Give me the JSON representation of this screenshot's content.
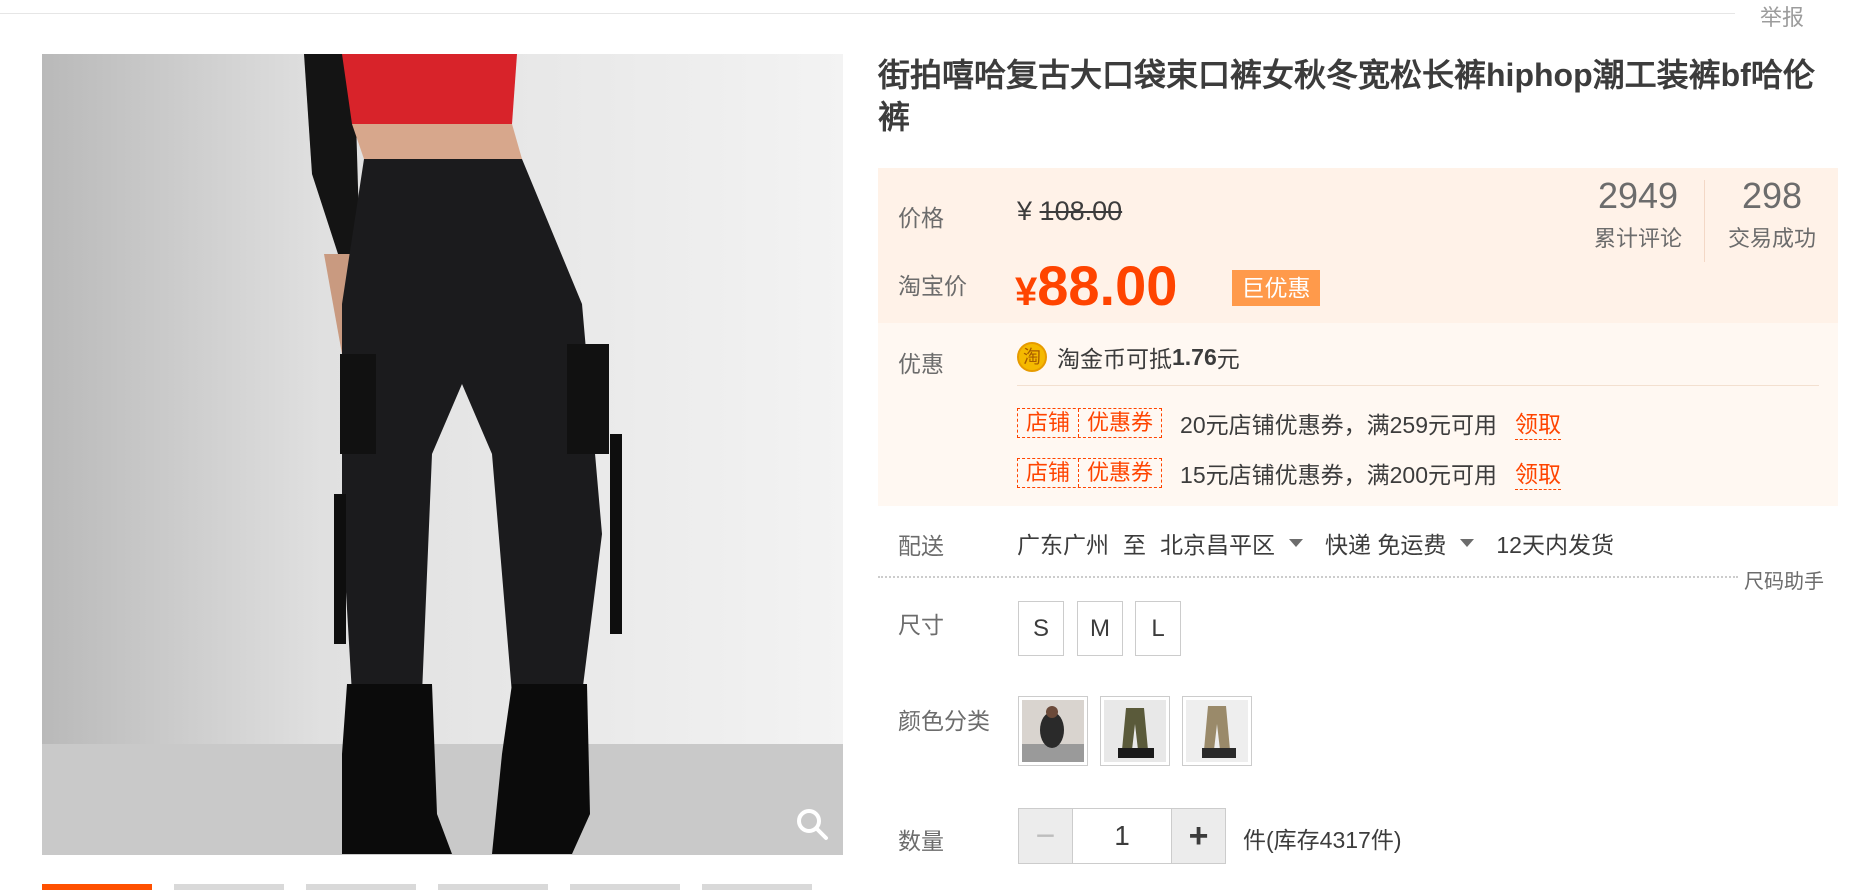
{
  "header": {
    "report_link": "举报"
  },
  "gallery": {
    "main_image_alt": "product-photo",
    "thumbnail_count": 6
  },
  "product": {
    "title": "街拍嘻哈复古大口袋束口裤女秋冬宽松长裤hiphop潮工装裤bf哈伦裤"
  },
  "price": {
    "price_label": "价格",
    "currency": "¥",
    "original_price": "108.00",
    "taobao_price_label": "淘宝价",
    "taobao_currency": "¥",
    "taobao_price": "88.00",
    "deal_badge": "巨优惠"
  },
  "stats": {
    "reviews_count": "2949",
    "reviews_label": "累计评论",
    "deals_count": "298",
    "deals_label": "交易成功"
  },
  "promotions": {
    "label": "优惠",
    "coin_icon_char": "淘",
    "coin_text_prefix": "淘金币可抵",
    "coin_amount": "1.76",
    "coin_text_suffix": "元",
    "coupons": [
      {
        "tag_left": "店铺",
        "tag_right": "优惠券",
        "text": "20元店铺优惠券，满259元可用",
        "action": "领取"
      },
      {
        "tag_left": "店铺",
        "tag_right": "优惠券",
        "text": "15元店铺优惠券，满200元可用",
        "action": "领取"
      }
    ]
  },
  "delivery": {
    "label": "配送",
    "from": "广东广州",
    "to_word": "至",
    "destination": "北京昌平区",
    "method": "快递 免运费",
    "ship_time": "12天内发货"
  },
  "size_helper": "尺码助手",
  "size": {
    "label": "尺寸",
    "options": [
      "S",
      "M",
      "L"
    ]
  },
  "color": {
    "label": "颜色分类",
    "options": [
      "color-swatch-1",
      "color-swatch-2",
      "color-swatch-3"
    ]
  },
  "quantity": {
    "label": "数量",
    "minus": "−",
    "value": "1",
    "plus": "+",
    "stock_text": "件(库存4317件)"
  },
  "colors": {
    "accent": "#ff4400",
    "badge": "#ff9a4b",
    "price_bg": "#fff2e8"
  }
}
